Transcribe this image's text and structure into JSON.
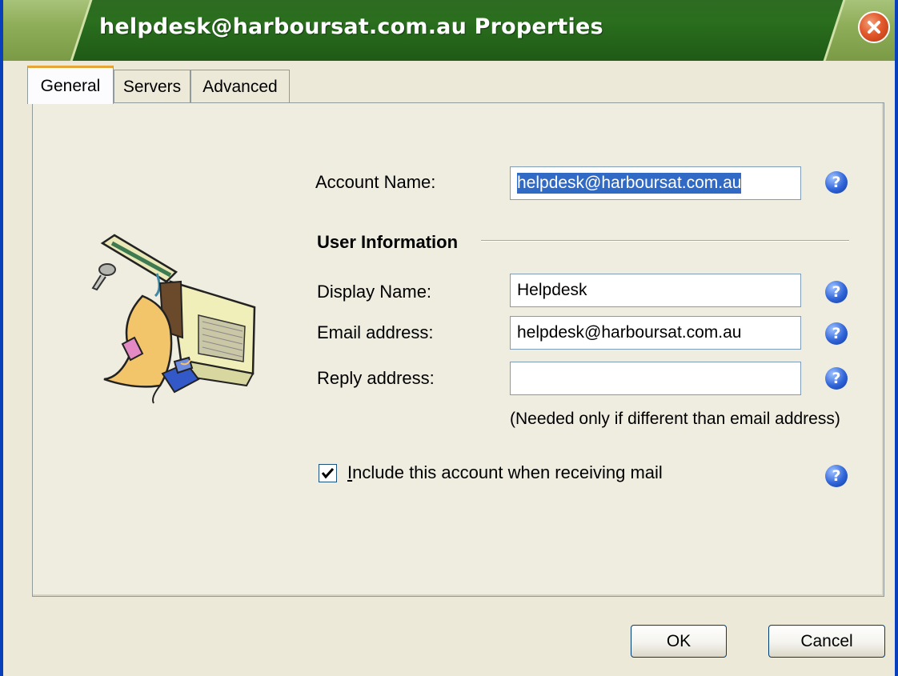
{
  "window": {
    "title": "helpdesk@harboursat.com.au Properties"
  },
  "tabs": [
    {
      "label": "General",
      "active": true
    },
    {
      "label": "Servers",
      "active": false
    },
    {
      "label": "Advanced",
      "active": false
    }
  ],
  "account": {
    "label": "Account Name:",
    "value": "helpdesk@harboursat.com.au"
  },
  "user_info": {
    "heading": "User Information",
    "display_name_label": "Display Name:",
    "display_name_value": "Helpdesk",
    "email_label": "Email address:",
    "email_value": "helpdesk@harboursat.com.au",
    "reply_label": "Reply address:",
    "reply_value": "",
    "reply_note": "(Needed only if different than email address)"
  },
  "include": {
    "label": "Include this account when receiving mail",
    "checked": true
  },
  "buttons": {
    "ok": "OK",
    "cancel": "Cancel"
  },
  "colors": {
    "titlebar": "#2a6e1e",
    "selection": "#316ac5",
    "help_icon": "#2f64d8",
    "close_button": "#e25a2c"
  }
}
